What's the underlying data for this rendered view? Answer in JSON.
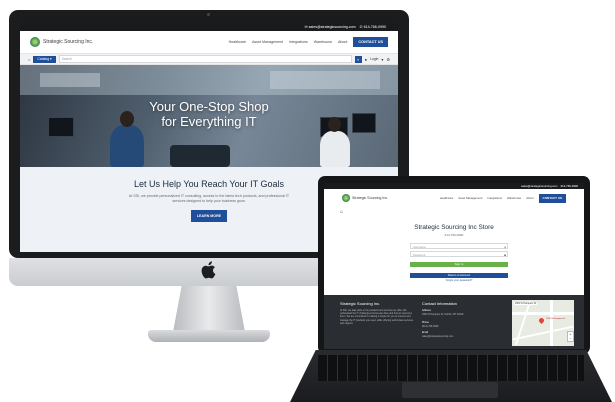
{
  "imac_site": {
    "contact_strip": [
      "✉ sales@strategicsourcing.com",
      "✆ 614-766-0990"
    ],
    "logo_text": "Strategic Sourcing Inc.",
    "nav": [
      "Healthcare",
      "Asset Management",
      "Integrations",
      "Warehouse",
      "About"
    ],
    "contact_button": "CONTACT US",
    "catalog_label": "Catalog ▾",
    "search_placeholder": "Search",
    "login_label": "Login",
    "hero_title_line1": "Your One-Stop Shop",
    "hero_title_line2": "for Everything IT",
    "goals_title": "Let Us Help You Reach Your IT Goals",
    "goals_text": "At SSI, we provide personalized IT consulting, access to the latest tech products, and professional IT services designed to help your business grow.",
    "learn_more": "LEARN MORE"
  },
  "laptop_site": {
    "contact_strip": [
      "sales@strategicsourcing.com",
      "614-766-0990"
    ],
    "logo_text": "Strategic Sourcing Inc.",
    "nav": [
      "Healthcare",
      "Asset Management",
      "Integrations",
      "Warehouse",
      "About"
    ],
    "contact_button": "CONTACT US",
    "store_title": "Strategic Sourcing Inc Store",
    "phone": "614-766-0990",
    "username_placeholder": "Username",
    "password_placeholder": "Password",
    "sign_in": "Sign In",
    "return_label": "Return to Account",
    "forgot": "Forgot your password?",
    "footer": {
      "company_heading": "Strategic Sourcing Inc.",
      "company_text": "At SSI, we take pride in the products and services we offer. We understand the IT challenges businesses face and how to overcome them. We are committed to making it simple for you to procure and manage the IT products you need, while offering world-class services and support.",
      "contact_heading": "Contact Information",
      "address_label": "Address",
      "address_text": "2550 N Hampton Dr, Dublin, OH 43016",
      "phone_label": "Phone",
      "phone_text": "(614) 766-0990",
      "email_label": "Email",
      "email_text": "sales@strategicsourcing.com",
      "map_label": "2550 N Hampton Dr",
      "map_pin_label": "2550 N Hampton Dr"
    }
  },
  "colors": {
    "brand_blue": "#1f4f9a",
    "brand_green": "#68b04a",
    "footer_dark": "#2a2d31"
  },
  "icons": [
    "apple-logo-icon",
    "home-icon",
    "search-icon",
    "cart-icon",
    "user-icon",
    "gear-icon",
    "map-pin-icon"
  ]
}
